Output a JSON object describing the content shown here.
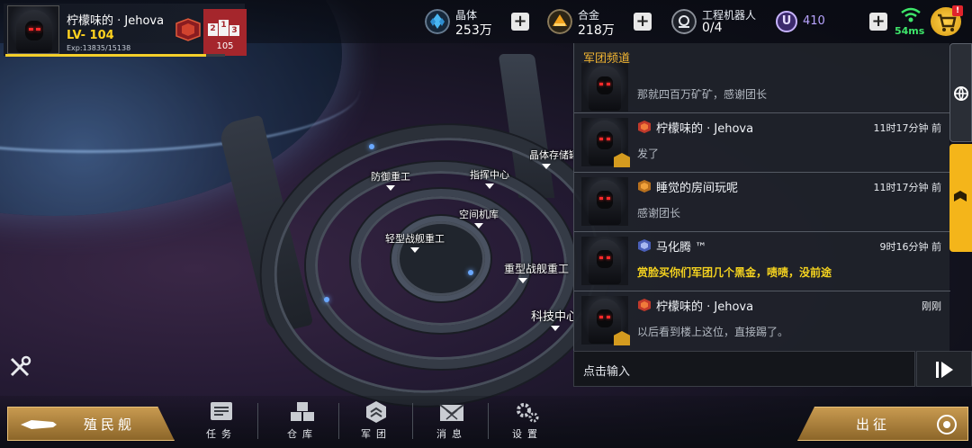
{
  "player": {
    "name": "柠檬味的 · Jehova",
    "level": "LV- 104",
    "exp": "Exp:13835/15138",
    "exp_fraction": 0.914,
    "rank_podium": [
      "2",
      "1",
      "3"
    ],
    "rank": "105"
  },
  "resources": {
    "crystal": {
      "label": "晶体",
      "value": "253万",
      "icon": "crystal-icon"
    },
    "alloy": {
      "label": "合金",
      "value": "218万",
      "icon": "alloy-icon"
    },
    "robots": {
      "label": "工程机器人",
      "value": "0/4",
      "icon": "robot-icon"
    },
    "u_currency": {
      "symbol": "U",
      "value": "410"
    }
  },
  "network": {
    "ping": "54ms"
  },
  "buildings": [
    {
      "id": "defense",
      "label": "防御重工"
    },
    {
      "id": "command",
      "label": "指挥中心"
    },
    {
      "id": "storage",
      "label": "晶体存储罐"
    },
    {
      "id": "hangar",
      "label": "空间机库"
    },
    {
      "id": "light-ship",
      "label": "轻型战舰重工"
    },
    {
      "id": "heavy-ship",
      "label": "重型战舰重工"
    },
    {
      "id": "tech",
      "label": "科技中心"
    }
  ],
  "chat": {
    "title": "军团频道",
    "messages": [
      {
        "name": "",
        "time": "",
        "text": "那就四百万矿矿，感谢团长",
        "highlight": false
      },
      {
        "name": "柠檬味的 · Jehova",
        "time": "11时17分钟 前",
        "text": "发了",
        "highlight": false
      },
      {
        "name": "睡觉的房间玩呢",
        "time": "11时17分钟 前",
        "text": "感谢团长",
        "highlight": false
      },
      {
        "name": "马化腾 ™",
        "time": "9时16分钟 前",
        "text": "赏脸买你们军团几个黑金，啧啧，没前途",
        "highlight": true
      },
      {
        "name": "柠檬味的 · Jehova",
        "time": "刚刚",
        "text": "以后看到楼上这位，直接踢了。",
        "highlight": false
      }
    ],
    "input_placeholder": "点击输入"
  },
  "bottom": {
    "colony_ship": "殖民舰",
    "deploy": "出征",
    "nav": [
      {
        "label": "任务",
        "icon": "tasks-icon"
      },
      {
        "label": "仓库",
        "icon": "warehouse-icon"
      },
      {
        "label": "军团",
        "icon": "legion-icon"
      },
      {
        "label": "消息",
        "icon": "messages-icon"
      },
      {
        "label": "设置",
        "icon": "settings-icon"
      }
    ]
  },
  "colors": {
    "accent_gold": "#f4b51a",
    "level_yellow": "#ffd21f",
    "chat_title": "#f3b632",
    "highlight_text": "#f4d21f",
    "ping_green": "#3ee66a",
    "rank_red": "#a5262c"
  }
}
